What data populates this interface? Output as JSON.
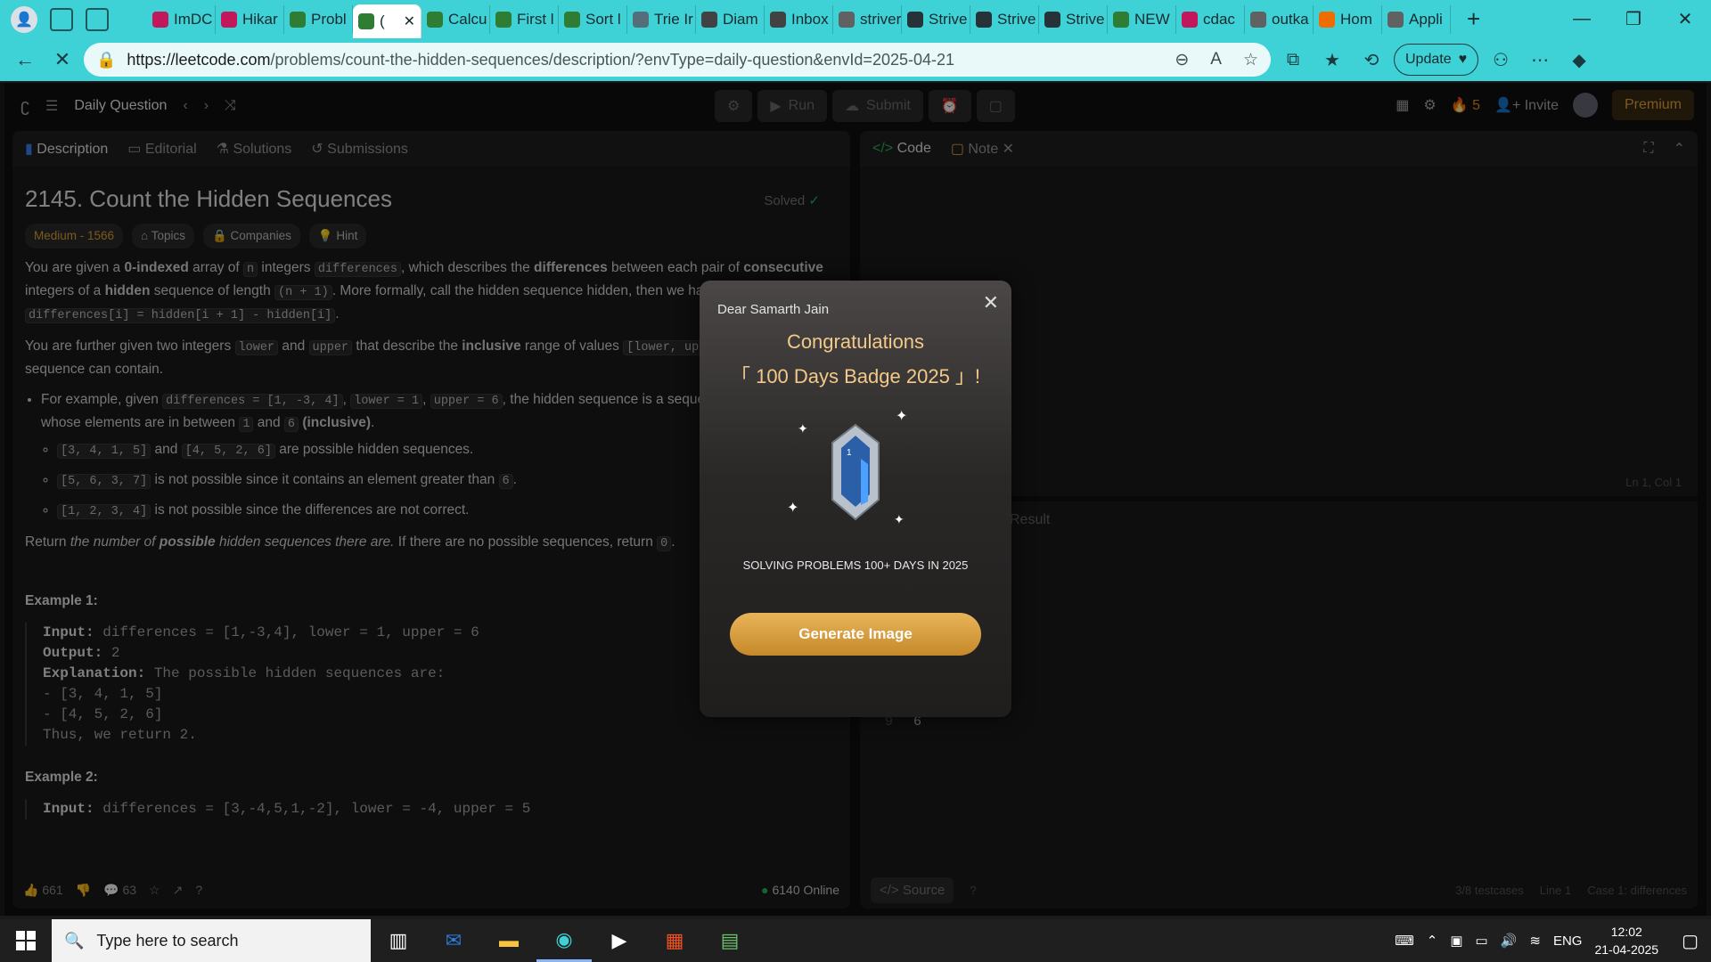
{
  "browser": {
    "tabs": [
      {
        "label": "ImDC",
        "color": "#c2185b"
      },
      {
        "label": "Hikar",
        "color": "#c2185b"
      },
      {
        "label": "Probl",
        "color": "#2e7d32"
      },
      {
        "label": "(",
        "color": "#2e7d32",
        "active": true
      },
      {
        "label": "Calcu",
        "color": "#2e7d32"
      },
      {
        "label": "First l",
        "color": "#2e7d32"
      },
      {
        "label": "Sort l",
        "color": "#2e7d32"
      },
      {
        "label": "Trie Ir",
        "color": "#546e7a"
      },
      {
        "label": "Diam",
        "color": "#424242"
      },
      {
        "label": "Inbox",
        "color": "#424242"
      },
      {
        "label": "striver",
        "color": "#616161"
      },
      {
        "label": "Strive",
        "color": "#263238"
      },
      {
        "label": "Strive",
        "color": "#263238"
      },
      {
        "label": "Strive",
        "color": "#263238"
      },
      {
        "label": "NEW",
        "color": "#2e7d32"
      },
      {
        "label": "cdac",
        "color": "#c2185b"
      },
      {
        "label": "outka",
        "color": "#616161"
      },
      {
        "label": "Hom",
        "color": "#ef6c00"
      },
      {
        "label": "Appli",
        "color": "#616161"
      }
    ],
    "url_host": "https://leetcode.com",
    "url_path": "/problems/count-the-hidden-sequences/description/?envType=daily-question&envId=2025-04-21",
    "update_label": "Update"
  },
  "lc": {
    "daily_label": "Daily Question",
    "run_label": "Run",
    "submit_label": "Submit",
    "streak_count": "5",
    "invite_label": "Invite",
    "premium_label": "Premium",
    "tabs": {
      "description": "Description",
      "editorial": "Editorial",
      "solutions": "Solutions",
      "submissions": "Submissions"
    },
    "code_tab": "Code",
    "note_tab": "Note",
    "title": "2145. Count the Hidden Sequences",
    "solved": "Solved",
    "difficulty": "Medium - 1566",
    "topics": "Topics",
    "companies": "Companies",
    "hint": "Hint",
    "example1_label": "Example 1:",
    "example2_label": "Example 2:",
    "likes": "661",
    "comments": "63",
    "online": "6140 Online",
    "source_label": "Source",
    "ln_col": "Ln 1, Col 1",
    "result_label": "Result",
    "editor_line_no": "9",
    "editor_line_val": "6",
    "footer_info": [
      "3/8 testcases",
      "Line 1",
      "Case 1: differences"
    ]
  },
  "modal": {
    "dear": "Dear Samarth Jain",
    "congrats": "Congratulations",
    "badge": "「 100 Days Badge 2025 」!",
    "subtitle": "SOLVING PROBLEMS 100+ DAYS IN 2025",
    "button": "Generate Image"
  },
  "taskbar": {
    "search_placeholder": "Type here to search",
    "lang": "ENG",
    "time": "12:02",
    "date": "21-04-2025"
  }
}
